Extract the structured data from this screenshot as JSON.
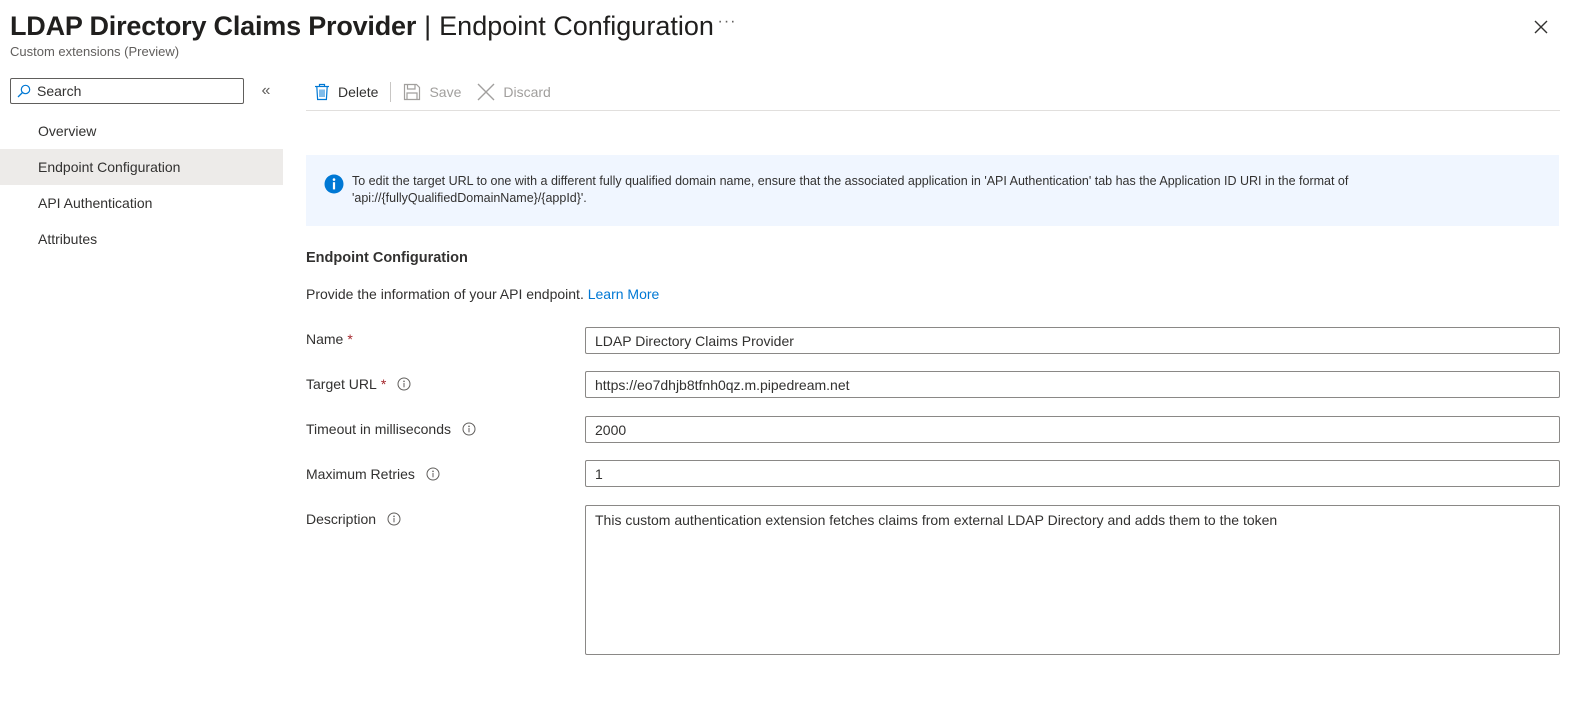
{
  "header": {
    "title_main": "LDAP Directory Claims Provider",
    "title_separator": "|",
    "title_page": "Endpoint Configuration",
    "more_label": "···",
    "subtitle": "Custom extensions (Preview)",
    "close_icon": "close-icon"
  },
  "sidebar": {
    "search_placeholder": "Search",
    "collapse_label": "«",
    "items": [
      {
        "label": "Overview",
        "active": false
      },
      {
        "label": "Endpoint Configuration",
        "active": true
      },
      {
        "label": "API Authentication",
        "active": false
      },
      {
        "label": "Attributes",
        "active": false
      }
    ]
  },
  "toolbar": {
    "delete_label": "Delete",
    "save_label": "Save",
    "discard_label": "Discard"
  },
  "info_banner": {
    "text_line1": "To edit the target URL to one with a different fully qualified domain name, ensure that the associated application in 'API Authentication' tab has the Application ID URI in the format of",
    "text_line2": "'api://{fullyQualifiedDomainName}/{appId}'."
  },
  "section": {
    "title": "Endpoint Configuration",
    "description": "Provide the information of your API endpoint.",
    "learn_more": "Learn More"
  },
  "form": {
    "name": {
      "label": "Name",
      "required_marker": "*",
      "value": "LDAP Directory Claims Provider"
    },
    "target_url": {
      "label": "Target URL",
      "required_marker": "*",
      "value": "https://eo7dhjb8tfnh0qz.m.pipedream.net"
    },
    "timeout": {
      "label": "Timeout in milliseconds",
      "value": "2000"
    },
    "max_retries": {
      "label": "Maximum Retries",
      "value": "1"
    },
    "description": {
      "label": "Description",
      "value": "This custom authentication extension fetches claims from external LDAP Directory and adds them to the token"
    }
  },
  "colors": {
    "accent": "#0078d4",
    "required": "#a4262c",
    "banner_bg": "#f0f6ff",
    "active_nav_bg": "#edebe9"
  }
}
